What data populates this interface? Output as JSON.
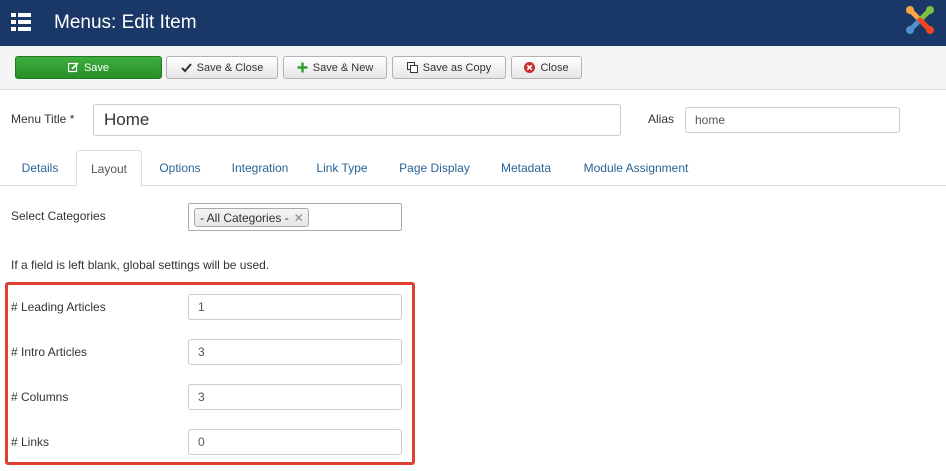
{
  "header": {
    "title": "Menus: Edit Item"
  },
  "toolbar": {
    "save": "Save",
    "save_close": "Save & Close",
    "save_new": "Save & New",
    "save_copy": "Save as Copy",
    "close": "Close"
  },
  "title_row": {
    "menu_title_label": "Menu Title *",
    "menu_title_value": "Home",
    "alias_label": "Alias",
    "alias_value": "home"
  },
  "tabs": [
    "Details",
    "Layout",
    "Options",
    "Integration",
    "Link Type",
    "Page Display",
    "Metadata",
    "Module Assignment"
  ],
  "active_tab": "Layout",
  "categories": {
    "label": "Select Categories",
    "chip": "- All Categories -"
  },
  "note": "If a field is left blank, global settings will be used.",
  "fields": [
    {
      "label": "# Leading Articles",
      "value": "1"
    },
    {
      "label": "# Intro Articles",
      "value": "3"
    },
    {
      "label": "# Columns",
      "value": "3"
    },
    {
      "label": "# Links",
      "value": "0"
    }
  ],
  "colors": {
    "header": "#1a3867",
    "save_button": "#2f9e2f",
    "highlight": "#e0402f",
    "link": "#2a6496"
  }
}
